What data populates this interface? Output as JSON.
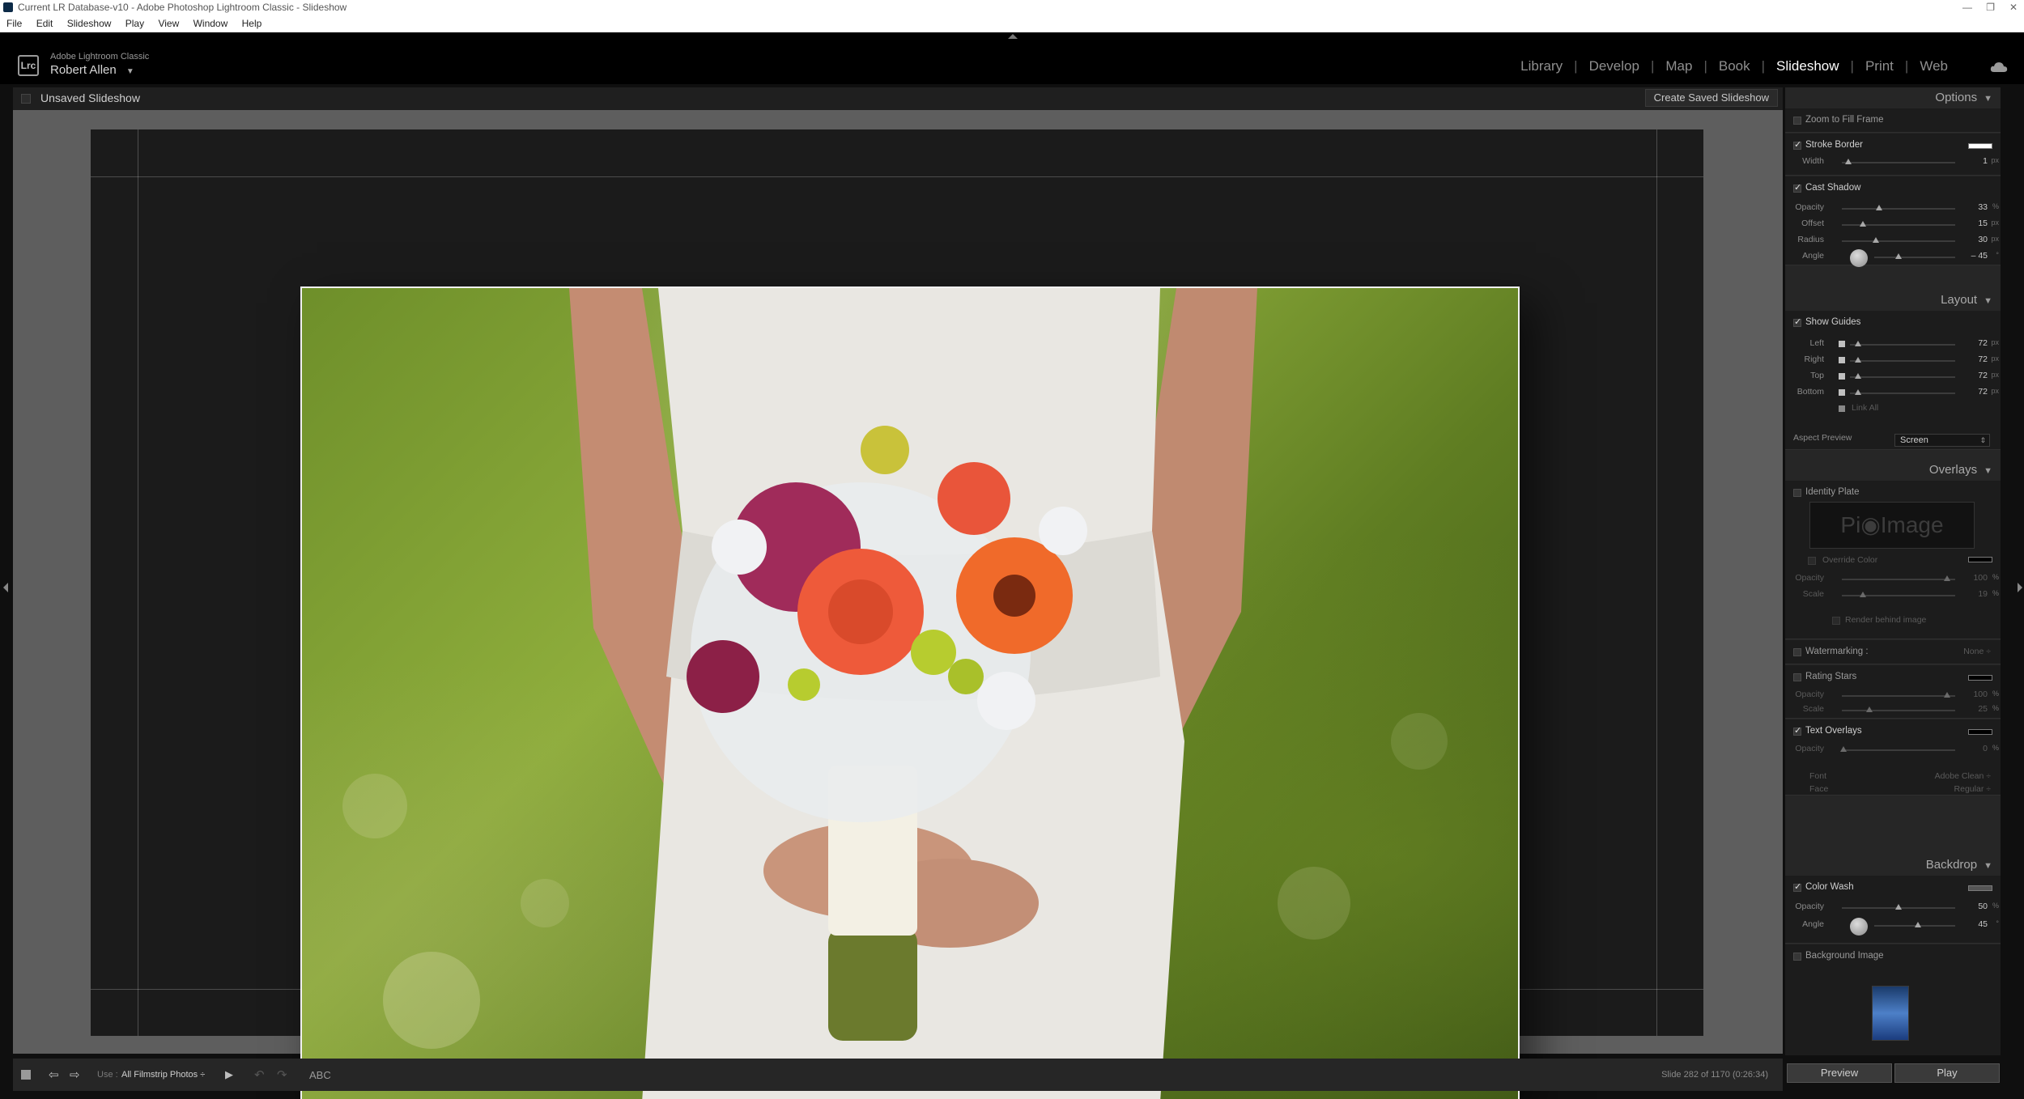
{
  "window": {
    "title": "Current LR Database-v10 - Adobe Photoshop Lightroom Classic - Slideshow",
    "controls": [
      "—",
      "❐",
      "✕"
    ]
  },
  "menu": [
    "File",
    "Edit",
    "Slideshow",
    "Play",
    "View",
    "Window",
    "Help"
  ],
  "header": {
    "logo": "Lrc",
    "product": "Adobe Lightroom Classic",
    "user": "Robert Allen",
    "modules": [
      "Library",
      "Develop",
      "Map",
      "Book",
      "Slideshow",
      "Print",
      "Web"
    ],
    "active_module": "Slideshow"
  },
  "center": {
    "slideshow_name": "Unsaved Slideshow",
    "create_saved": "Create Saved Slideshow"
  },
  "panel": {
    "options": {
      "header": "Options",
      "zoom_to_fill": "Zoom to Fill Frame",
      "stroke_border": "Stroke Border",
      "width_label": "Width",
      "width_value": "1",
      "width_unit": "px",
      "cast_shadow": "Cast Shadow",
      "opacity_label": "Opacity",
      "opacity_value": "33",
      "offset_label": "Offset",
      "offset_value": "15",
      "radius_label": "Radius",
      "radius_value": "30",
      "angle_label": "Angle",
      "angle_value": "– 45",
      "pct": "%",
      "px": "px",
      "deg": "°"
    },
    "layout": {
      "header": "Layout",
      "show_guides": "Show Guides",
      "left": "Left",
      "right": "Right",
      "top": "Top",
      "bottom": "Bottom",
      "value": "72",
      "link_all": "Link All",
      "aspect_preview": "Aspect Preview",
      "aspect_value": "Screen"
    },
    "overlays": {
      "header": "Overlays",
      "identity_plate": "Identity Plate",
      "plate_text": "Pi◉Image",
      "override_color": "Override Color",
      "opacity": "Opacity",
      "opacity_value": "100",
      "scale": "Scale",
      "scale_value": "19",
      "render_behind": "Render behind image",
      "watermarking": "Watermarking :",
      "watermark_value": "None ÷",
      "rating_stars": "Rating Stars",
      "rs_opacity_value": "100",
      "rs_scale_value": "25",
      "text_overlays": "Text Overlays",
      "to_opacity_value": "0",
      "font": "Font",
      "font_value": "Adobe Clean ÷",
      "face": "Face",
      "face_value": "Regular ÷"
    },
    "backdrop": {
      "header": "Backdrop",
      "color_wash": "Color Wash",
      "opacity": "Opacity",
      "opacity_value": "50",
      "angle": "Angle",
      "angle_value": "45",
      "background_image": "Background Image"
    },
    "preview_button": "Preview",
    "play_button": "Play"
  },
  "toolbar": {
    "use_label": "Use :",
    "use_value": "All Filmstrip Photos ÷",
    "abc": "ABC",
    "slide_info": "Slide 282 of 1170 (0:26:34)"
  },
  "colors": {
    "accent": "#ffffff",
    "panel_bg": "#262626",
    "stage_bg": "#5e5e5e",
    "slide_bg": "#1b1b1b"
  }
}
